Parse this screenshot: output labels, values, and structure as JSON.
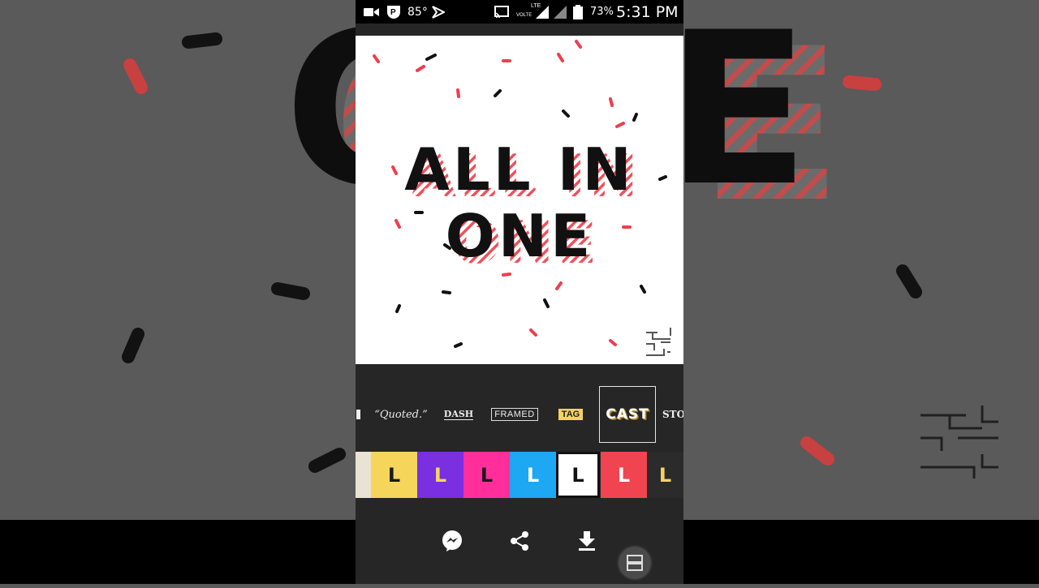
{
  "status_bar": {
    "temperature": "85°",
    "network": "LTE",
    "volte": "VOLTE",
    "battery": "73%",
    "time": "5:31 PM",
    "icons": [
      "video-camera-icon",
      "pocket-icon",
      "flipboard-icon",
      "cast-icon",
      "signal-icon",
      "battery-icon"
    ]
  },
  "canvas": {
    "headline_line1": "ALL IN",
    "headline_line2": "ONE",
    "text_color": "#111111",
    "stripe_color": "#f0505a",
    "confetti_colors": [
      "#ee3e4e",
      "#111111"
    ],
    "watermark": "layout-logo-icon"
  },
  "styles": {
    "items": [
      {
        "label": "Quoted."
      },
      {
        "label": "DASH"
      },
      {
        "label": "FRAMED"
      },
      {
        "label": "TAG"
      },
      {
        "label": "CAST",
        "selected": true
      },
      {
        "label": "STOP"
      }
    ]
  },
  "swatches": {
    "letter": "L",
    "items": [
      {
        "bg": "#e8e3d2",
        "fg": "#222222"
      },
      {
        "bg": "#f5d65b",
        "fg": "#1a1a1a"
      },
      {
        "bg": "#7a2fe0",
        "fg": "#f5d65b"
      },
      {
        "bg": "#ff2e9a",
        "fg": "#1a1a1a"
      },
      {
        "bg": "#1ea7f2",
        "fg": "#ffffff"
      },
      {
        "bg": "#ffffff",
        "fg": "#111111",
        "selected": true
      },
      {
        "bg": "#f04550",
        "fg": "#ffffff"
      },
      {
        "bg": "#2b2b2b",
        "fg": "#f5d65b"
      }
    ]
  },
  "actions": {
    "icons": [
      "messenger-icon",
      "share-icon",
      "download-icon",
      "layout-icon"
    ]
  }
}
